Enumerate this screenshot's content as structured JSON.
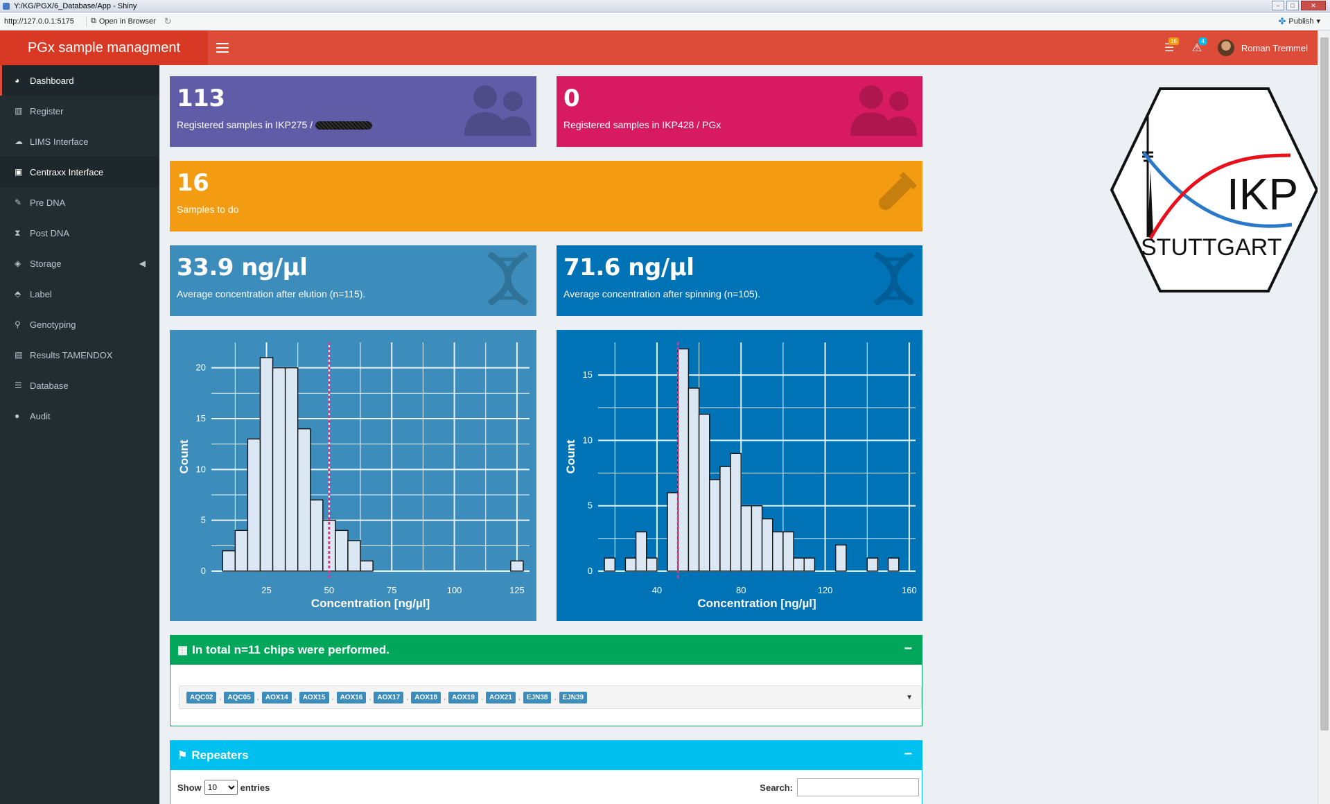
{
  "window": {
    "title": "Y:/KG/PGX/6_Database/App - Shiny",
    "url": "http://127.0.0.1:5175",
    "open_in_browser": "Open in Browser",
    "publish": "Publish"
  },
  "header": {
    "app_title": "PGx sample managment",
    "tasks_badge": "16",
    "alerts_badge": "4",
    "user_name": "Roman Tremmel"
  },
  "sidebar": {
    "items": [
      {
        "label": "Dashboard",
        "icon": "dashboard-icon"
      },
      {
        "label": "Register",
        "icon": "barcode-icon"
      },
      {
        "label": "LIMS Interface",
        "icon": "cloud-upload-icon"
      },
      {
        "label": "Centraxx Interface",
        "icon": "address-book-icon"
      },
      {
        "label": "Pre DNA",
        "icon": "eyedropper-icon"
      },
      {
        "label": "Post DNA",
        "icon": "hourglass-icon"
      },
      {
        "label": "Storage",
        "icon": "layers-icon"
      },
      {
        "label": "Label",
        "icon": "tags-icon"
      },
      {
        "label": "Genotyping",
        "icon": "microscope-icon"
      },
      {
        "label": "Results TAMENDOX",
        "icon": "bar-chart-icon"
      },
      {
        "label": "Database",
        "icon": "database-icon"
      },
      {
        "label": "Audit",
        "icon": "circle-icon"
      }
    ]
  },
  "boxes": {
    "ikp275": {
      "value": "113",
      "label": "Registered samples in IKP275 /",
      "color": "#605ca8"
    },
    "ikp428": {
      "value": "0",
      "label": "Registered samples in IKP428 / PGx",
      "color": "#d81b60"
    },
    "todo": {
      "value": "16",
      "label": "Samples to do",
      "color": "#f39c12"
    },
    "elution": {
      "value": "33.9 ng/µl",
      "label": "Average concentration after elution (n=115).",
      "color": "#3c8dbc"
    },
    "spinning": {
      "value": "71.6 ng/µl",
      "label": "Average concentration after spinning (n=105).",
      "color": "#0073b7"
    }
  },
  "chart_data": [
    {
      "type": "bar",
      "subtype": "histogram",
      "xlabel": "Concentration [ng/µl]",
      "ylabel": "Count",
      "xlim": [
        3,
        130
      ],
      "ylim": [
        0,
        22.5
      ],
      "xticks": [
        25,
        50,
        75,
        100,
        125
      ],
      "yticks": [
        0,
        5,
        10,
        15,
        20
      ],
      "bin_width": 5,
      "bins": [
        {
          "x0": 7.5,
          "count": 2
        },
        {
          "x0": 12.5,
          "count": 4
        },
        {
          "x0": 17.5,
          "count": 13
        },
        {
          "x0": 22.5,
          "count": 21
        },
        {
          "x0": 27.5,
          "count": 20
        },
        {
          "x0": 32.5,
          "count": 20
        },
        {
          "x0": 37.5,
          "count": 14
        },
        {
          "x0": 42.5,
          "count": 7
        },
        {
          "x0": 47.5,
          "count": 5
        },
        {
          "x0": 52.5,
          "count": 4
        },
        {
          "x0": 57.5,
          "count": 3
        },
        {
          "x0": 62.5,
          "count": 1
        },
        {
          "x0": 122.5,
          "count": 1
        }
      ],
      "vline": 50,
      "vline_color": "#e0338f",
      "grid": true
    },
    {
      "type": "bar",
      "subtype": "histogram",
      "xlabel": "Concentration [ng/µl]",
      "ylabel": "Count",
      "xlim": [
        12,
        163
      ],
      "ylim": [
        0,
        17.5
      ],
      "xticks": [
        40,
        80,
        120,
        160
      ],
      "yticks": [
        0,
        5,
        10,
        15
      ],
      "bin_width": 5,
      "bins": [
        {
          "x0": 15,
          "count": 1
        },
        {
          "x0": 25,
          "count": 1
        },
        {
          "x0": 30,
          "count": 3
        },
        {
          "x0": 35,
          "count": 1
        },
        {
          "x0": 45,
          "count": 6
        },
        {
          "x0": 50,
          "count": 17
        },
        {
          "x0": 55,
          "count": 14
        },
        {
          "x0": 60,
          "count": 12
        },
        {
          "x0": 65,
          "count": 7
        },
        {
          "x0": 70,
          "count": 8
        },
        {
          "x0": 75,
          "count": 9
        },
        {
          "x0": 80,
          "count": 5
        },
        {
          "x0": 85,
          "count": 5
        },
        {
          "x0": 90,
          "count": 4
        },
        {
          "x0": 95,
          "count": 3
        },
        {
          "x0": 100,
          "count": 3
        },
        {
          "x0": 105,
          "count": 1
        },
        {
          "x0": 110,
          "count": 1
        },
        {
          "x0": 125,
          "count": 2
        },
        {
          "x0": 140,
          "count": 1
        },
        {
          "x0": 150,
          "count": 1
        }
      ],
      "vline": 50,
      "vline_color": "#e0338f",
      "grid": true
    }
  ],
  "chips_panel": {
    "title": "In total n=11 chips were performed.",
    "color": "#00a65a",
    "chips": [
      "AQC02",
      "AQC05",
      "AOX14",
      "AOX15",
      "AOX16",
      "AOX17",
      "AOX18",
      "AOX19",
      "AOX21",
      "EJN38",
      "EJN39"
    ]
  },
  "repeaters_panel": {
    "title": "Repeaters",
    "color": "#00c0ef",
    "show_label": "Show",
    "page_length": "10",
    "entries_label": "entries",
    "search_label": "Search:"
  },
  "logo": {
    "text_main": "IKP",
    "text_sub": "STUTTGART"
  }
}
